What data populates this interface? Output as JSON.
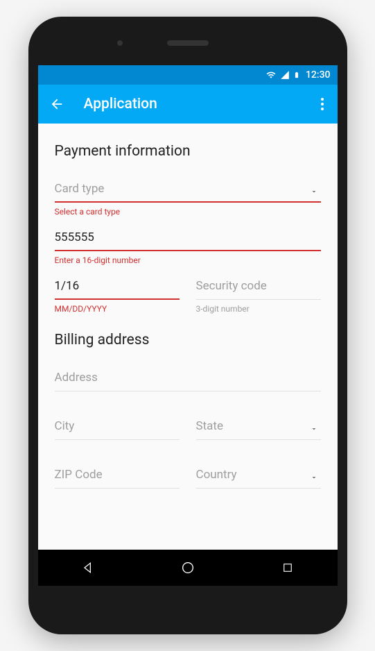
{
  "status": {
    "time": "12:30"
  },
  "appbar": {
    "title": "Application"
  },
  "payment": {
    "heading": "Payment information",
    "card_type": {
      "placeholder": "Card type",
      "error": "Select a card type"
    },
    "card_number": {
      "value": "555555",
      "error": "Enter a 16-digit number"
    },
    "expiry": {
      "value": "1/16",
      "helper": "MM/DD/YYYY"
    },
    "security": {
      "placeholder": "Security code",
      "helper": "3-digit number"
    }
  },
  "billing": {
    "heading": "Billing address",
    "address": {
      "placeholder": "Address"
    },
    "city": {
      "placeholder": "City"
    },
    "state": {
      "placeholder": "State"
    },
    "zip": {
      "placeholder": "ZIP Code"
    },
    "country": {
      "placeholder": "Country"
    }
  }
}
